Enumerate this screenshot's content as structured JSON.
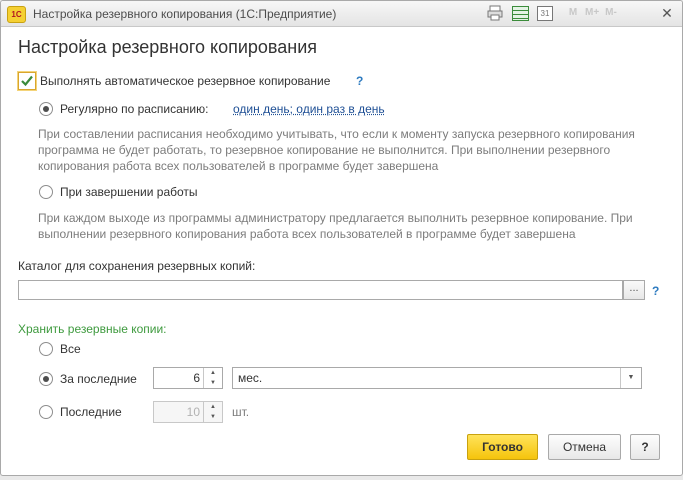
{
  "window": {
    "title": "Настройка резервного копирования  (1С:Предприятие)",
    "logo_text": "1С"
  },
  "toolbar": {
    "icons": [
      "print-icon",
      "table-icon",
      "calendar-icon",
      "m-icon",
      "m-plus-icon",
      "m-minus-icon",
      "close-icon"
    ],
    "calendar_day": "31",
    "m_label": "M",
    "mplus_label": "M+",
    "mminus_label": "M-",
    "close_label": "✕"
  },
  "form": {
    "title": "Настройка резервного копирования",
    "auto_backup": {
      "label": "Выполнять автоматическое резервное копирование",
      "checked": true,
      "help": "?"
    },
    "schedule": {
      "label": "Регулярно по расписанию:",
      "selected": true,
      "link": "один день; один раз в день",
      "note": "При составлении расписания необходимо учитывать, что если к моменту запуска резервного копирования программа не будет работать, то резервное копирование не выполнится. При выполнении резервного копирования работа всех пользователей в программе будет завершена"
    },
    "on_exit": {
      "label": "При завершении работы",
      "selected": false,
      "note": "При каждом выходе из программы администратору предлагается выполнить резервное копирование. При выполнении резервного копирования работа всех пользователей в программе будет завершена"
    },
    "directory": {
      "label": "Каталог для сохранения резервных копий:",
      "value": "",
      "browse": "...",
      "help": "?"
    },
    "retention": {
      "title": "Хранить резервные копии:",
      "all_label": "Все",
      "last_period_label": "За последние",
      "last_period_value": "6",
      "last_period_unit": "мес.",
      "last_count_label": "Последние",
      "last_count_value": "10",
      "last_count_unit": "шт.",
      "selected": "last_period"
    }
  },
  "buttons": {
    "ok": "Готово",
    "cancel": "Отмена",
    "help": "?"
  },
  "colors": {
    "accent_yellow": "#f5c40c",
    "link_blue": "#1e4f95",
    "group_green": "#3e9a3e",
    "help_blue": "#2e7bc0"
  }
}
